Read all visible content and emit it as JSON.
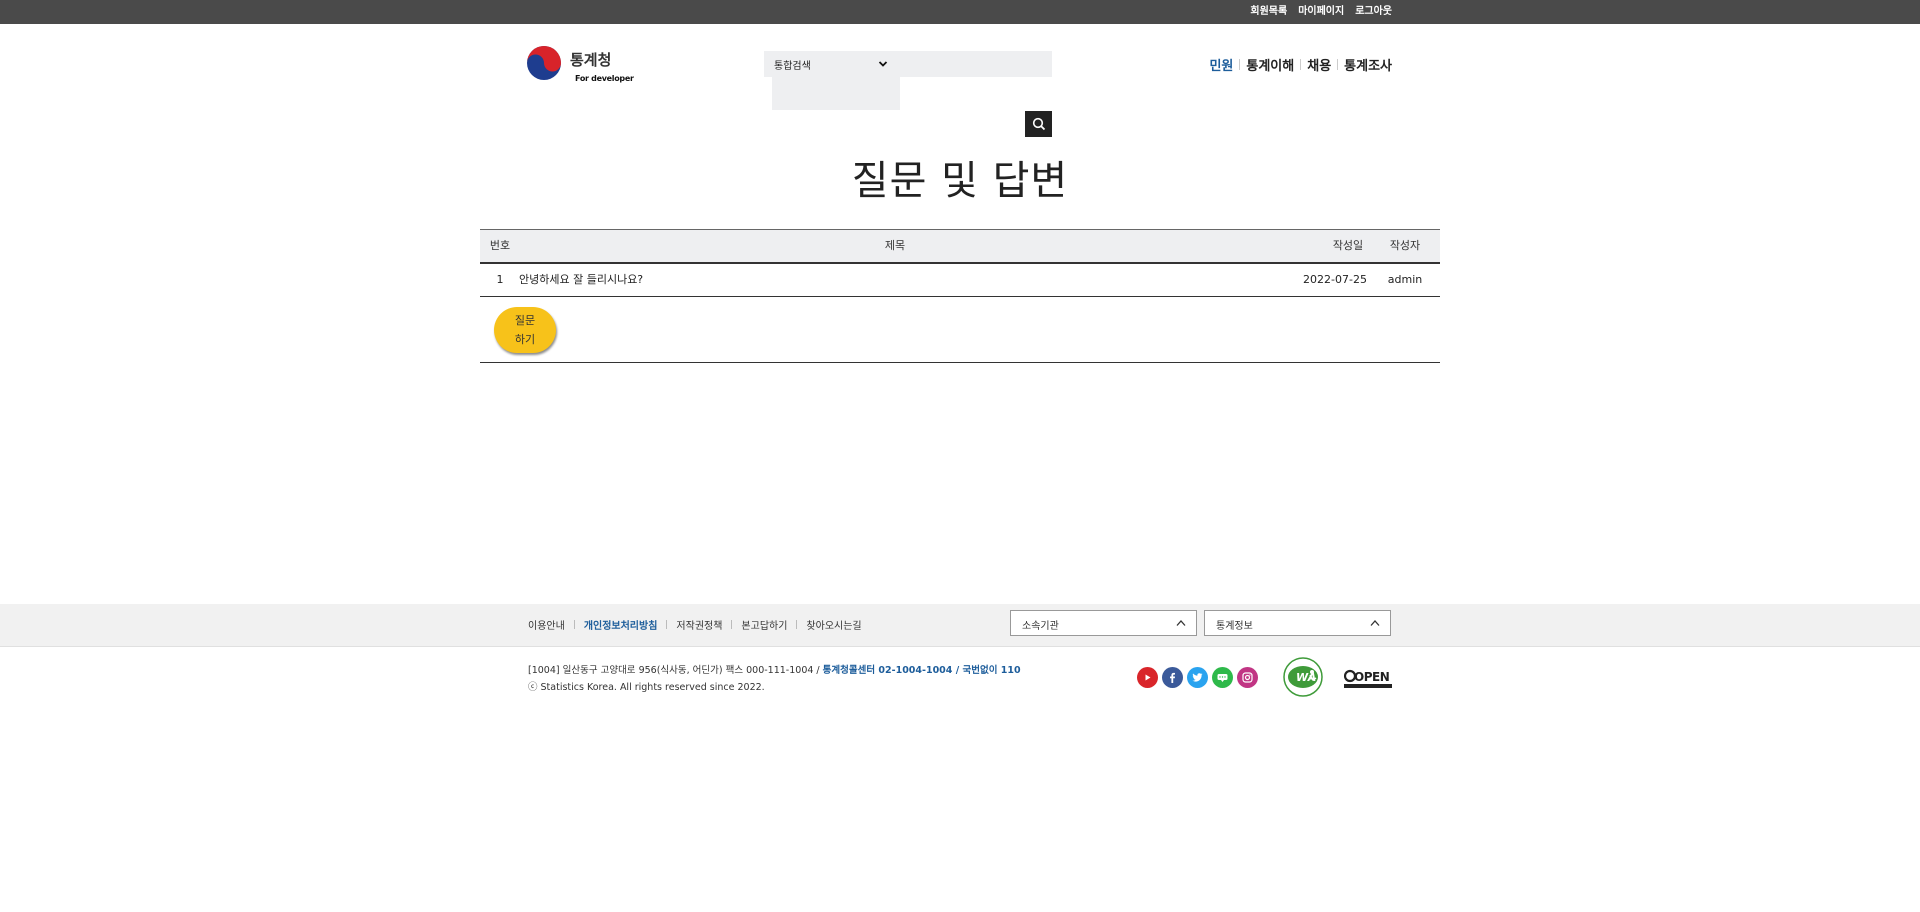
{
  "utility_links": [
    "회원목록",
    "마이페이지",
    "로그아웃"
  ],
  "logo": {
    "title": "통계청",
    "subtitle": "For developer"
  },
  "search": {
    "scope_label": "통합검색",
    "query": "",
    "placeholder": ""
  },
  "gnb": [
    {
      "label": "민원",
      "active": true
    },
    {
      "label": "통계이해",
      "active": false
    },
    {
      "label": "채용",
      "active": false
    },
    {
      "label": "통계조사",
      "active": false
    }
  ],
  "page_title": "질문 및 답변",
  "board": {
    "columns": {
      "number": "번호",
      "title": "제목",
      "date": "작성일",
      "author": "작성자"
    },
    "rows": [
      {
        "number": "1",
        "title": "안녕하세요 잘 들리시나요?",
        "date": "2022-07-25",
        "author": "admin"
      }
    ],
    "ask_button": "질문\n하기"
  },
  "footer": {
    "links": [
      {
        "label": "이용안내",
        "highlight": false
      },
      {
        "label": "개인정보처리방침",
        "highlight": true
      },
      {
        "label": "저작권정책",
        "highlight": false
      },
      {
        "label": "본고답하기",
        "highlight": false
      },
      {
        "label": "찾아오시는길",
        "highlight": false
      }
    ],
    "selects": [
      "소속기관",
      "통계정보"
    ],
    "address": "[1004] 일산동구 고양대로 956(식사동, 어딘가) 팩스 000-111-1004 /",
    "contact": "통계청콜센터 02-1004-1004 / 국번없이 110",
    "copyright": "ⓒ Statistics Korea. All rights reserved since 2022.",
    "sns": [
      {
        "icon": "youtube-icon",
        "color": "#d9252a"
      },
      {
        "icon": "facebook-icon",
        "color": "#3b5a9a"
      },
      {
        "icon": "twitter-icon",
        "color": "#2aa3ef"
      },
      {
        "icon": "blog-icon",
        "color": "#2eb94a"
      },
      {
        "icon": "instagram-icon",
        "color": "#c13584"
      }
    ],
    "badges": {
      "wa": "WA",
      "open": "OPEN"
    }
  },
  "colors": {
    "accent": "#1d5d9b",
    "ask_button": "#f7c21a",
    "topbar": "#4a4a4a"
  }
}
